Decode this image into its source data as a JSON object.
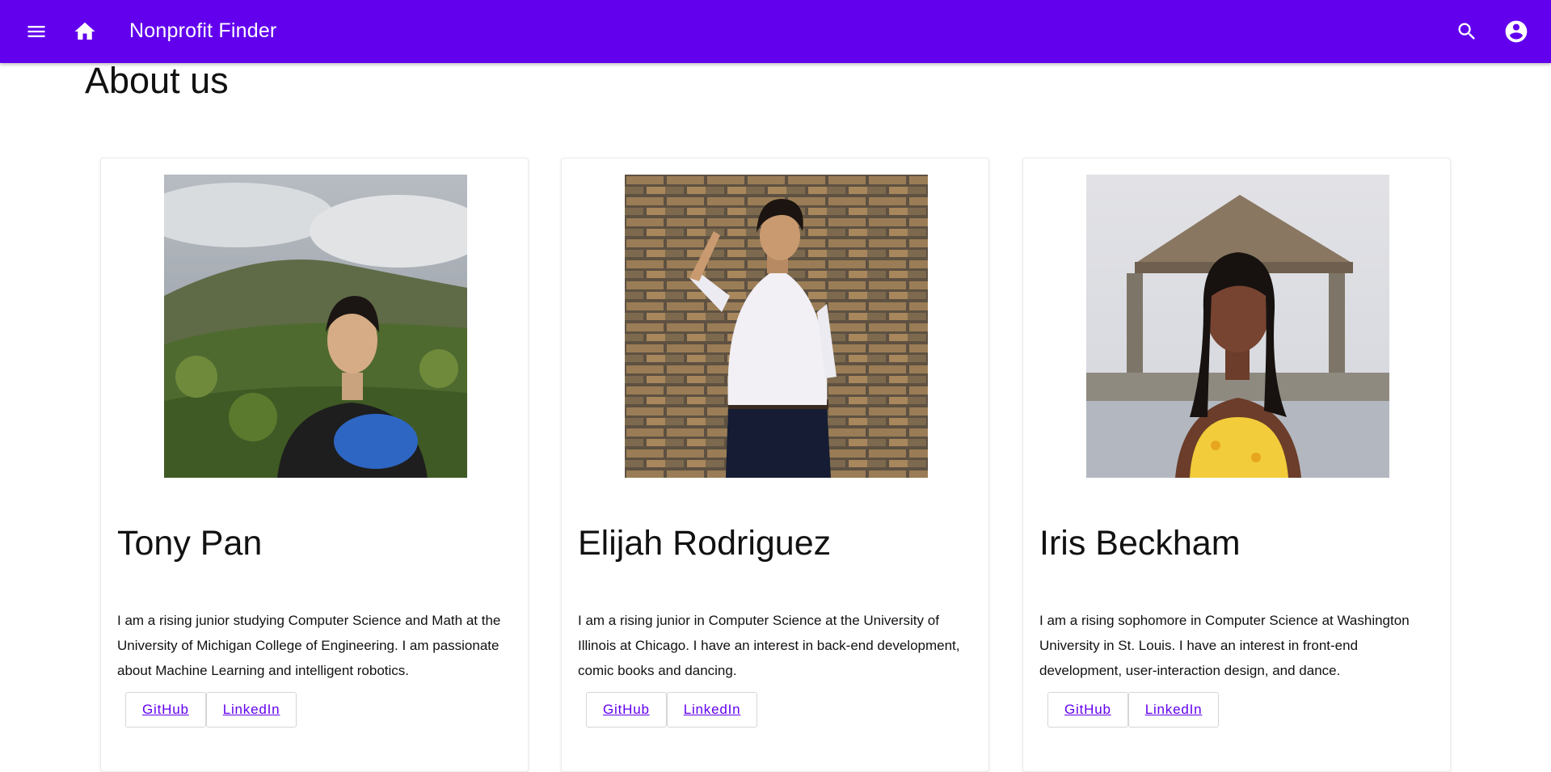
{
  "app": {
    "title": "Nonprofit Finder",
    "accent": "#6200ee",
    "icons": [
      "menu-icon",
      "home-icon",
      "search-icon",
      "account-icon"
    ]
  },
  "page": {
    "title": "About us"
  },
  "team": [
    {
      "name": "Tony Pan",
      "bio": "I am a rising junior studying Computer Science and Math at the University of Michigan College of Engineering. I am passionate about Machine Learning and intelligent robotics.",
      "github_label": "GitHub",
      "linkedin_label": "LinkedIn"
    },
    {
      "name": "Elijah Rodriguez",
      "bio": "I am a rising junior in Computer Science at the University of Illinois at Chicago. I have an interest in back-end development, comic books and dancing.",
      "github_label": "GitHub",
      "linkedin_label": "LinkedIn"
    },
    {
      "name": "Iris Beckham",
      "bio": "I am a rising sophomore in Computer Science at Washington University in St. Louis. I have an interest in front-end development, user-interaction design, and dance.",
      "github_label": "GitHub",
      "linkedin_label": "LinkedIn"
    }
  ]
}
